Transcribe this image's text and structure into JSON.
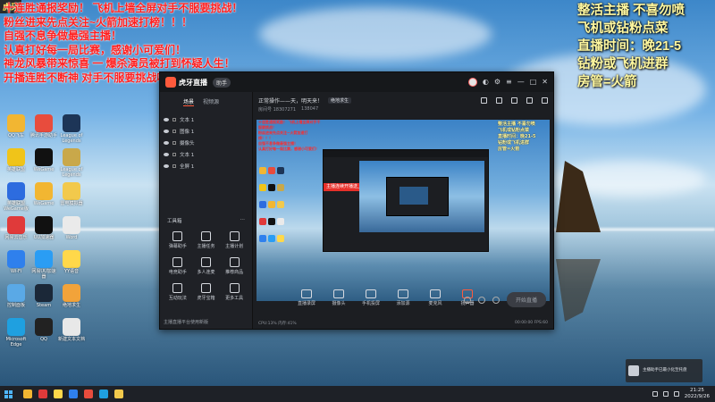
{
  "overlay": {
    "corner_tag": "虎牙",
    "red_lines": [
      "十连胜通报奖励！ 飞机上墙全屏对手不服要挑战！",
      "粉丝进来先点关注~火箭加速打榜！！！",
      "自强不息争做最强主播！",
      "认真打好每一局比赛，感谢小可爱们！",
      "神龙风暴带来惊喜 一 爆杀演员被打到怀疑人生！",
      "开播连胜不断神 对手不服要挑战吃鸡！"
    ],
    "yellow_lines": [
      "整活主播 不喜勿喷",
      "飞机或钻粉点菜",
      "直播时间：晚21-5",
      "钻粉或飞机进群",
      "房管=火箭"
    ]
  },
  "desktop_icons": [
    {
      "label": "QQ飞车",
      "color": "#f2b632"
    },
    {
      "label": "腾讯手游助手",
      "color": "#e84c3d"
    },
    {
      "label": "League of Legends",
      "color": "#1d3557"
    },
    {
      "label": "英雄联盟",
      "color": "#f0c419"
    },
    {
      "label": "WeGame",
      "color": "#111111"
    },
    {
      "label": "League of Legends",
      "color": "#c9a84a"
    },
    {
      "label": "英雄联盟WeGame版",
      "color": "#2d6cdf"
    },
    {
      "label": "WeGame",
      "color": "#f2b632"
    },
    {
      "label": "雷电模拟器",
      "color": "#f2c94c"
    },
    {
      "label": "网易云音乐",
      "color": "#e03a3a"
    },
    {
      "label": "UU加速器",
      "color": "#111111"
    },
    {
      "label": "Word",
      "color": "#eaeaea"
    },
    {
      "label": "Wi-Fi",
      "color": "#2f80ed"
    },
    {
      "label": "网易UU加速器",
      "color": "#2a9df4"
    },
    {
      "label": "YY语音",
      "color": "#ffd84a"
    },
    {
      "label": "控制面板",
      "color": "#5aa9e6"
    },
    {
      "label": "Steam",
      "color": "#1b2838"
    },
    {
      "label": "绝地求生",
      "color": "#f2a33a"
    },
    {
      "label": "Microsoft Edge",
      "color": "#1fa0e0"
    },
    {
      "label": "QQ",
      "color": "#222222"
    },
    {
      "label": "新建文本文档",
      "color": "#e8e8e8"
    }
  ],
  "app": {
    "brand": "虎牙直播",
    "version_badge": "助手",
    "scene_tabs": [
      "场景",
      "视频源"
    ],
    "scenes": [
      "文本 1",
      "图像 1",
      "摄像头",
      "文本 1",
      "全屏 1"
    ],
    "toolbox_title": "工具箱",
    "tools": [
      "弹幕助手",
      "主播任务",
      "主播计划",
      "电竞助手",
      "多人连麦",
      "推荐商品",
      "互动玩法",
      "虎牙宝箱",
      "更多工具"
    ],
    "left_footer": "主播直播平台使用新版",
    "stream_title": "正常操作——天，明天来！",
    "stream_tag": "绝地求生",
    "stream_room": "房间号 18307271",
    "stream_fans": "138047",
    "inner_banner": "主播连续开播送上屏幕~",
    "controls": [
      "直播录屏",
      "摄像头",
      "手机投屏",
      "添加源",
      "麦克风",
      "扬声器"
    ],
    "start_label": "开始直播",
    "status_left": "CPU:13%  内存:41%",
    "status_right": "00:00:00  FPS:60"
  },
  "notification": {
    "text": "主播助手已最小化至托盘"
  },
  "taskbar": {
    "time": "21:25",
    "date": "2022/9/26",
    "app_colors": [
      "#f2b632",
      "#e03a3a",
      "#ffd84a",
      "#2f80ed",
      "#e84c3d",
      "#1fa0e0",
      "#f2c94c"
    ]
  }
}
